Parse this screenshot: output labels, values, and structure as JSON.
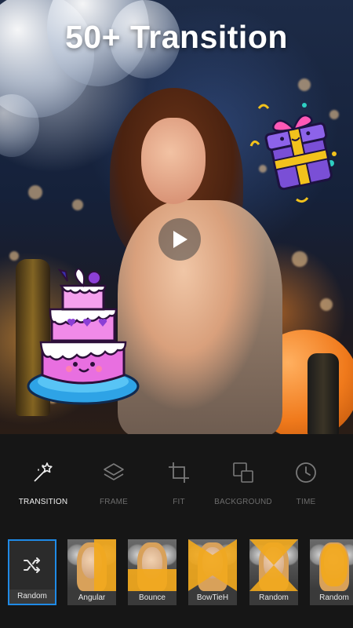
{
  "headline": "50+ Transition",
  "preview": {
    "play_icon": "play-icon",
    "stickers": [
      "gift-box-sticker",
      "birthday-cake-sticker"
    ]
  },
  "tools": [
    {
      "label": "TRANSITION",
      "icon": "magic-wand-icon",
      "active": true
    },
    {
      "label": "FRAME",
      "icon": "layers-icon",
      "active": false
    },
    {
      "label": "FIT",
      "icon": "crop-icon",
      "active": false
    },
    {
      "label": "BACKGROUND",
      "icon": "background-icon",
      "active": false
    },
    {
      "label": "TIME",
      "icon": "clock-icon",
      "active": false
    }
  ],
  "transitions": [
    {
      "label": "Random",
      "icon": "shuffle-icon",
      "selected": true
    },
    {
      "label": "Angular",
      "selected": false
    },
    {
      "label": "Bounce",
      "selected": false
    },
    {
      "label": "BowTieH",
      "selected": false
    },
    {
      "label": "Random",
      "selected": false
    },
    {
      "label": "Random",
      "selected": false
    }
  ],
  "colors": {
    "accent_selected": "#1f8ae6",
    "toolbar_bg": "#161616",
    "active_label": "#f2f2f2",
    "inactive_label": "#6d6d6d"
  }
}
